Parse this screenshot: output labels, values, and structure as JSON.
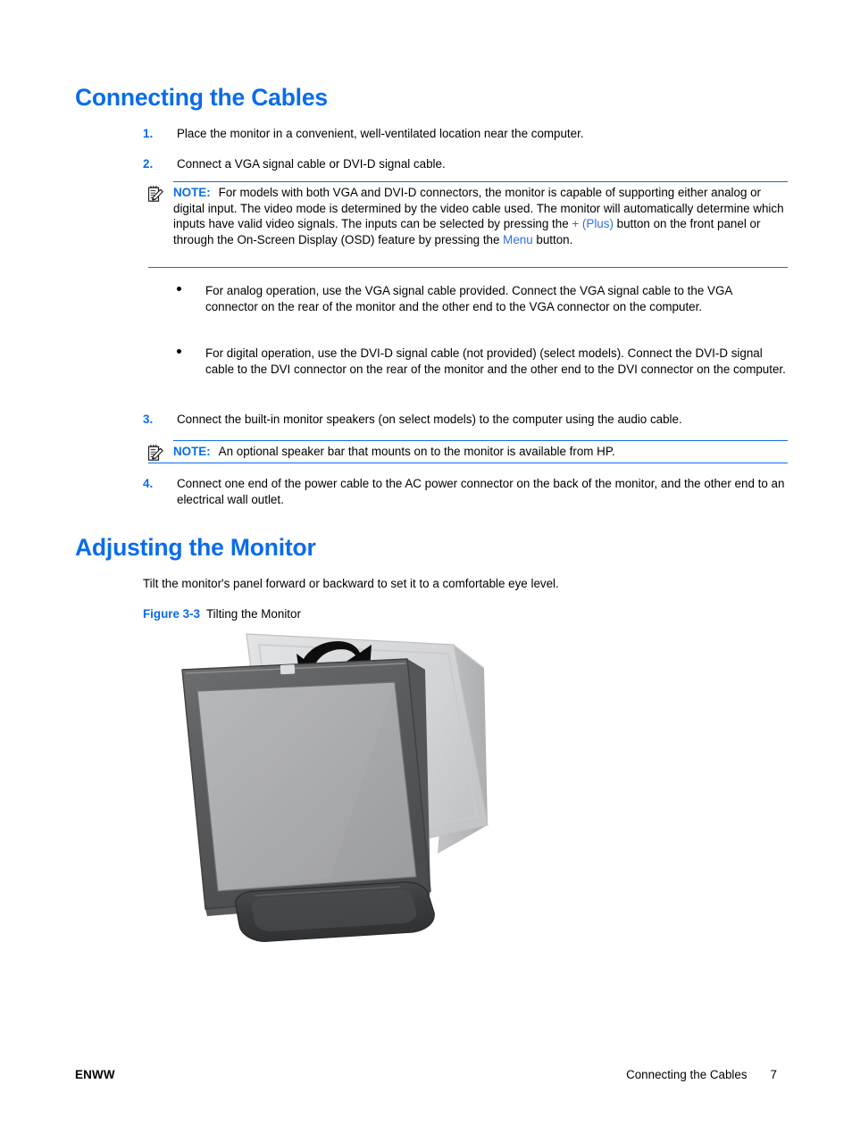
{
  "document": {
    "heading_cables": "Connecting the Cables",
    "heading_adjusting": "Adjusting the Monitor"
  },
  "steps": [
    {
      "marker": "1.",
      "text": "Place the monitor in a convenient, well-ventilated location near the computer."
    },
    {
      "marker": "2.",
      "text": "Connect a VGA signal cable or DVI-D signal cable."
    },
    {
      "marker": "3.",
      "text": "Connect the built-in monitor speakers (on select models) to the computer using the audio cable."
    },
    {
      "marker": "4.",
      "text": "Connect one end of the power cable to the AC power connector on the back of the monitor, and the other end to an electrical wall outlet."
    }
  ],
  "note_1": {
    "icon": "note-pencil-icon",
    "label": "NOTE:",
    "text_part_1": "For models with both VGA and DVI-D connectors, the monitor is capable of supporting either analog or digital input. The video mode is determined by the video cable used. The monitor will automatically determine which inputs have valid video signals. The inputs can be selected by pressing the ",
    "link_1": "+ (Plus)",
    "text_part_2": " button on the front panel or through the On-Screen Display (OSD) feature by pressing the ",
    "link_2": "Menu",
    "text_part_3": " button."
  },
  "note_2": {
    "icon": "note-pencil-icon",
    "label": "NOTE:",
    "text": "An optional speaker bar that mounts on to the monitor is available from HP."
  },
  "bullets": [
    {
      "text": "For analog operation, use the VGA signal cable provided. Connect the VGA signal cable to the VGA connector on the rear of the monitor and the other end to the VGA connector on the computer."
    },
    {
      "text": "For digital operation, use the DVI-D signal cable (not provided) (select models). Connect the DVI-D signal cable to the DVI connector on the rear of the monitor and the other end to the DVI connector on the computer."
    }
  ],
  "adjusting": {
    "intro": "Tilt the monitor's panel forward or backward to set it to a comfortable eye level.",
    "figure_number": "Figure 3-3",
    "figure_title": "Tilting the Monitor"
  },
  "figure": {
    "alt": "Illustration of an HP flat-panel monitor shown tilting forward, with a ghosted outline of the monitor in the reclined position and a curved double-headed arrow above indicating the tilt motion.",
    "arrow_icon": "curved-double-arrow-icon",
    "brand_logo": "hp-logo"
  },
  "footer": {
    "left": "ENWW",
    "chapter": "Connecting the Cables",
    "page": "7"
  },
  "colors": {
    "heading_blue": "#0a6cea",
    "link_blue": "#2f6fe0",
    "rule_blue": "#0a6cea",
    "text_black": "#000000",
    "monitor_bezel_dark": "#58595b",
    "monitor_screen_gray": "#a8a9ab",
    "ghost_monitor_gray": "#d5d6d8",
    "base_dark": "#3f4042"
  }
}
